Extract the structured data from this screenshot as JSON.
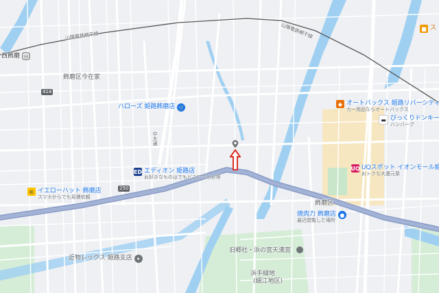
{
  "map": {
    "colors": {
      "background": "#eef0f3",
      "water": "#9fd0f2",
      "park": "#c8e6c9",
      "shopping": "#f6e7c1",
      "road": "#ffffff",
      "highway": "#8a9cc7",
      "railway": "#555555",
      "marker_red": "#d93025"
    },
    "labels": {
      "station_west": "西飾磨",
      "railway_left": "山陽電鉄網干線",
      "railway_right": "山陽電鉄網干線",
      "area_imazaike": "飾磨区今在家",
      "area_shikama": "飾磨区",
      "road_414": "414",
      "road_250": "250",
      "road_vertical": "中大通",
      "shrine": "旧郷社・浜の宮天満宮",
      "area_hamate": "浜手緑地",
      "area_hamate_sub": "(細江地区)",
      "top_right_poi": "ス"
    },
    "pois": {
      "hello_works": {
        "name": "ハローズ 姫路飾磨店",
        "icon": "shopping-cart-icon"
      },
      "edion": {
        "name": "エディオン 姫路店",
        "sub": "お好きなものはでもどこにでもお得",
        "icon": "edion-logo-icon"
      },
      "yellow_hat": {
        "name": "イエローハット 飾磨店",
        "sub": "スマホからでも見積依頼",
        "icon": "car-shop-icon"
      },
      "autobacs": {
        "name": "オートバックス 姫路リバーシティ",
        "sub": "カー用品ならオートバックス",
        "icon": "autobacs-logo-icon"
      },
      "bikkuri": {
        "name": "びっくりドンキー",
        "sub": "ハンバーグ",
        "icon": "restaurant-icon"
      },
      "uq": {
        "name": "UQスポット イオンモール姫",
        "sub": "おトクな大還元祭",
        "icon": "uq-logo-icon"
      },
      "yakiniku": {
        "name": "焼肉力 飾磨店",
        "sub": "最近閲覧した場所",
        "icon": "lock-pin-icon"
      },
      "kintetsu": {
        "name": "近物レックス 姫路支店",
        "icon": "place-dot-icon"
      }
    }
  }
}
